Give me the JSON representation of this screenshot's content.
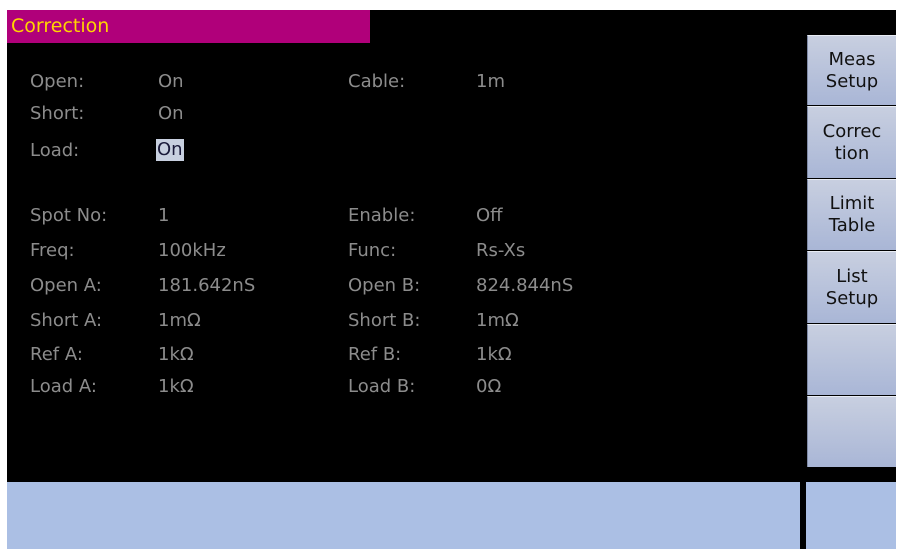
{
  "title": "Correction",
  "settings": {
    "open_label": "Open:",
    "open_value": "On",
    "short_label": "Short:",
    "short_value": "On",
    "load_label": "Load:",
    "load_value": "On",
    "cable_label": "Cable:",
    "cable_value": "1m"
  },
  "spot": {
    "spot_no_label": "Spot No:",
    "spot_no_value": "1",
    "enable_label": "Enable:",
    "enable_value": "Off",
    "freq_label": "Freq:",
    "freq_value": "100kHz",
    "func_label": "Func:",
    "func_value": "Rs-Xs",
    "open_a_label": "Open A:",
    "open_a_value": "181.642nS",
    "open_b_label": "Open B:",
    "open_b_value": "824.844nS",
    "short_a_label": "Short A:",
    "short_a_value": "1mΩ",
    "short_b_label": "Short B:",
    "short_b_value": "1mΩ",
    "ref_a_label": "Ref A:",
    "ref_a_value": "1kΩ",
    "ref_b_label": "Ref B:",
    "ref_b_value": "1kΩ",
    "load_a_label": "Load A:",
    "load_a_value": "1kΩ",
    "load_b_label": "Load B:",
    "load_b_value": "0Ω"
  },
  "softkeys": [
    {
      "label": "Meas\nSetup"
    },
    {
      "label": "Correc\ntion"
    },
    {
      "label": "Limit\nTable"
    },
    {
      "label": "List\nSetup"
    },
    {
      "label": ""
    },
    {
      "label": ""
    }
  ],
  "colors": {
    "title_bg": "#b0007a",
    "title_text": "#ffd400",
    "label_text": "#8c8c8c",
    "highlight_bg": "#c8d0e0",
    "softkey_bg": "#b4c0dc",
    "status_bar_bg": "#abbfe4"
  }
}
